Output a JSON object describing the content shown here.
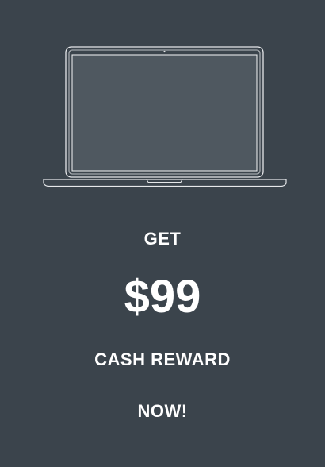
{
  "promo": {
    "get_label": "GET",
    "amount": "$99",
    "reward_label": "CASH REWARD",
    "cta_label": "NOW!"
  },
  "icons": {
    "laptop": "laptop-icon"
  },
  "colors": {
    "background": "#3b444c",
    "screen": "#4f5860",
    "outline": "#e6e8ea",
    "text": "#ffffff"
  }
}
